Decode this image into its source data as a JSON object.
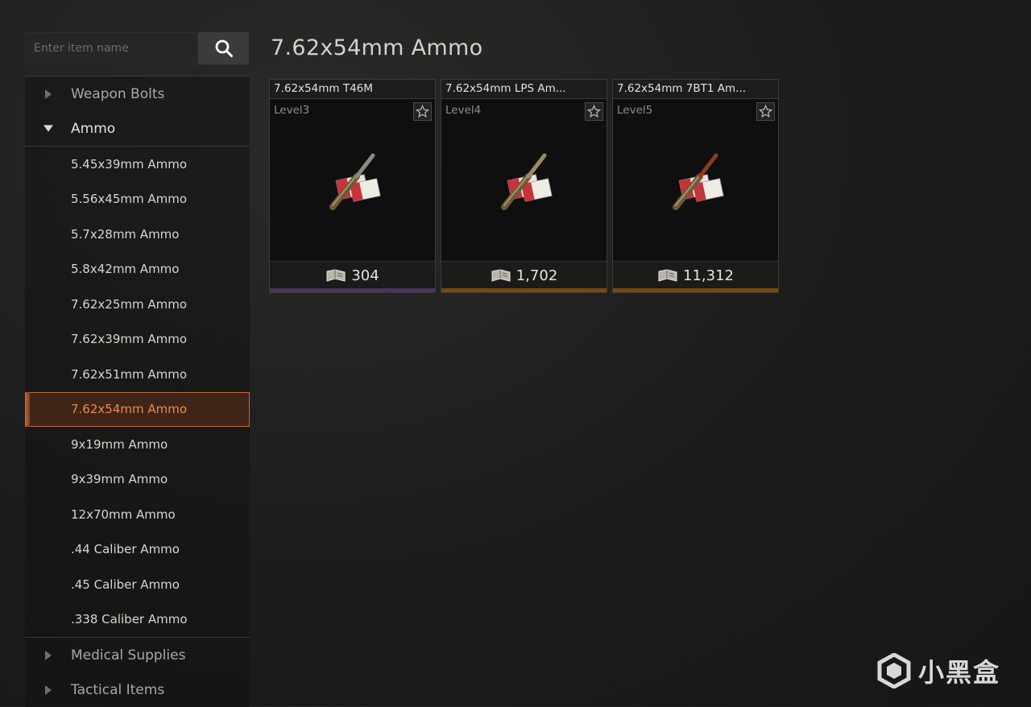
{
  "search": {
    "placeholder": "Enter item name"
  },
  "page_title": "7.62x54mm Ammo",
  "sidebar": {
    "top_categories": [
      {
        "label": "Weapon Bolts",
        "open": false
      },
      {
        "label": "Ammo",
        "open": true
      }
    ],
    "ammo_items": [
      {
        "label": "5.45x39mm Ammo"
      },
      {
        "label": "5.56x45mm Ammo"
      },
      {
        "label": "5.7x28mm Ammo"
      },
      {
        "label": "5.8x42mm Ammo"
      },
      {
        "label": "7.62x25mm Ammo"
      },
      {
        "label": "7.62x39mm Ammo"
      },
      {
        "label": "7.62x51mm Ammo"
      },
      {
        "label": "7.62x54mm Ammo",
        "active": true
      },
      {
        "label": "9x19mm Ammo"
      },
      {
        "label": "9x39mm Ammo"
      },
      {
        "label": "12x70mm Ammo"
      },
      {
        "label": ".44 Caliber Ammo"
      },
      {
        "label": ".45 Caliber Ammo"
      },
      {
        "label": ".338 Caliber Ammo"
      }
    ],
    "bottom_categories": [
      {
        "label": "Medical Supplies"
      },
      {
        "label": "Tactical Items"
      }
    ]
  },
  "cards": [
    {
      "name": "7.62x54mm T46M",
      "level": "Level3",
      "price": "304",
      "rarity_color": "#4a3358",
      "tip_color": "#8a8a7e"
    },
    {
      "name": "7.62x54mm LPS Am...",
      "level": "Level4",
      "price": "1,702",
      "rarity_color": "#7a4612",
      "tip_color": "#9a8a66"
    },
    {
      "name": "7.62x54mm 7BT1 Am...",
      "level": "Level5",
      "price": "11,312",
      "rarity_color": "#7a4612",
      "tip_color": "#8f3a1e"
    }
  ],
  "watermark": {
    "text": "小黑盒"
  },
  "colors": {
    "accent": "#c56a36",
    "active_text": "#e88a52"
  }
}
